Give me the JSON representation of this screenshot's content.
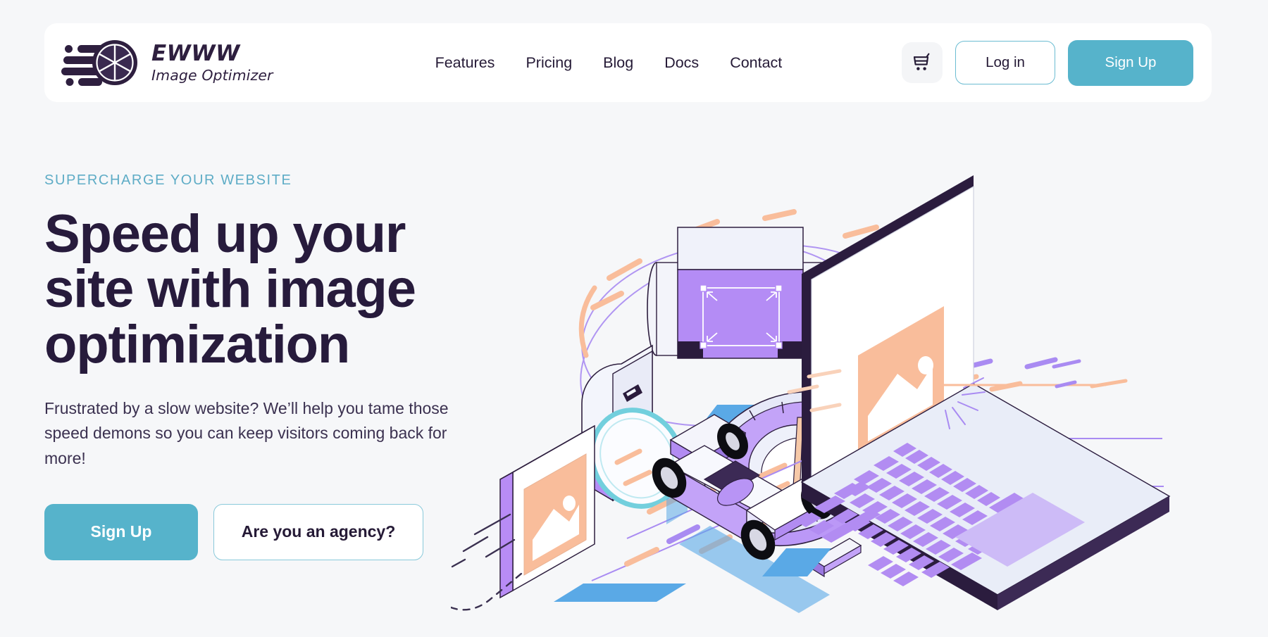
{
  "brand": {
    "logo_icon": "camera-aperture-speed-icon",
    "name": "EWWW",
    "tagline": "Image Optimizer"
  },
  "header": {
    "nav": [
      {
        "label": "Features"
      },
      {
        "label": "Pricing"
      },
      {
        "label": "Blog"
      },
      {
        "label": "Docs"
      },
      {
        "label": "Contact"
      }
    ],
    "cart_icon": "shopping-cart-icon",
    "login_label": "Log in",
    "signup_label": "Sign Up"
  },
  "hero": {
    "eyebrow": "SUPERCHARGE YOUR WEBSITE",
    "title": "Speed up your site with image optimization",
    "subtitle": "Frustrated by a slow website? We’ll help you tame those speed demons so you can keep visitors coming back for more!",
    "primary_cta": "Sign Up",
    "secondary_cta": "Are you an agency?",
    "illustration": "isometric-image-optimization-scene"
  },
  "colors": {
    "page_background": "#f6f7f9",
    "surface": "#ffffff",
    "brand_teal": "#56b3cb",
    "brand_teal_border": "#6bbcd2",
    "eyebrow_teal": "#5eacc6",
    "ink": "#271b3c",
    "body_text": "#3b3150",
    "accent_purple": "#a78bf0",
    "accent_purple_light": "#c9b4f7",
    "accent_peach": "#f9bd9b",
    "accent_blue": "#5aa9e6",
    "dark_outline": "#2e1f3f"
  }
}
